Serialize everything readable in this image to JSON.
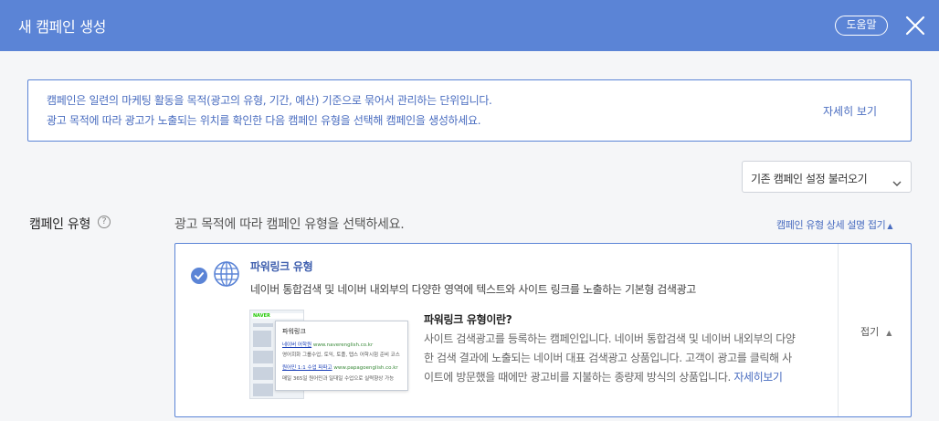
{
  "header": {
    "title": "새 캠페인 생성",
    "help_label": "도움말"
  },
  "info": {
    "line1": "캠페인은 일련의 마케팅 활동을 목적(광고의 유형, 기간, 예산) 기준으로 묶어서 관리하는 단위입니다.",
    "line2": "광고 목적에 따라 광고가 노출되는 위치를 확인한 다음 캠페인 유형을 선택해 캠페인을 생성하세요.",
    "more_label": "자세히 보기"
  },
  "load_button": {
    "label": "기존 캠페인 설정 불러오기"
  },
  "campaign_type": {
    "label": "캠페인 유형",
    "help_glyph": "?",
    "guide": "광고 목적에 따라 캠페인 유형을 선택하세요.",
    "collapse_all_label": "캠페인 유형 상세 설명 접기"
  },
  "card": {
    "title": "파워링크 유형",
    "description": "네이버 통합검색 및 네이버 내외부의 다양한 영역에 텍스트와 사이트 링크를 노출하는 기본형 검색광고",
    "what_title": "파워링크 유형이란?",
    "what_lines": [
      "사이트 검색광고를 등록하는 캠페인입니다. 네이버 통합검색 및 네이버 내외부의 다양",
      "한 검색 결과에 노출되는 네이버 대표 검색광고 상품입니다. 고객이 광고를 클릭해 사",
      "이트에 방문했을 때에만 광고비를 지불하는 종량제 방식의 상품입니다."
    ],
    "more_label": "자세히보기",
    "collapse_label": "접기",
    "preview": {
      "brand": "NAVER",
      "popup_title": "파워링크",
      "ad1_title": "네이버 어학원",
      "ad1_url": "www.naverenglish.co.kr",
      "ad1_desc": "영어회화 그룹수업, 토익, 토플, 텝스 어학시험 준비 코스",
      "ad2_title": "원어민 1:1 수업 파파고",
      "ad2_url": "www.papagoenglish.co.kr",
      "ad2_desc": "매일 365일 원어민과 일대일 수업으로 실력향상 가능"
    }
  },
  "colors": {
    "header": "#5b84d6",
    "accent": "#4a6dc0",
    "border": "#5b84d6"
  },
  "icons": {
    "close": "close-icon",
    "check": "check-circle-icon",
    "globe": "globe-icon",
    "chevron": "chevron-down-icon",
    "help": "question-circle-icon"
  }
}
